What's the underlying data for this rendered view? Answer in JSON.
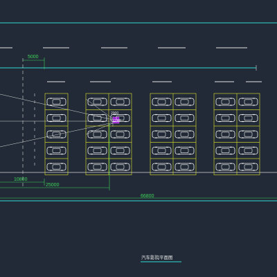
{
  "drawing": {
    "title": "汽车影院平面图",
    "dimensions": {
      "top_offset": "5000",
      "bottom_left": "10800",
      "bottom_mid": "25000",
      "overall": "66800"
    },
    "screen_label": "2000",
    "screen_sub": "12,00",
    "parking_blocks": [
      {
        "name": "block-a",
        "columns": 1,
        "rows": 5
      },
      {
        "name": "block-b",
        "columns": 2,
        "rows": 5
      },
      {
        "name": "block-c",
        "columns": 2,
        "rows": 5
      },
      {
        "name": "block-d",
        "columns": 2,
        "rows": 5
      }
    ]
  },
  "colors": {
    "background": "#212a36",
    "road_line": "#2fb9b3",
    "lane_dash": "#e6e6e6",
    "stall": "#c8cc2e",
    "car": "#f2f2f2",
    "dimension": "#3fd55a",
    "sightline": "#dcdcdc",
    "screen": "#9b1fd4"
  },
  "icons": {
    "car": "car-outline-icon"
  }
}
